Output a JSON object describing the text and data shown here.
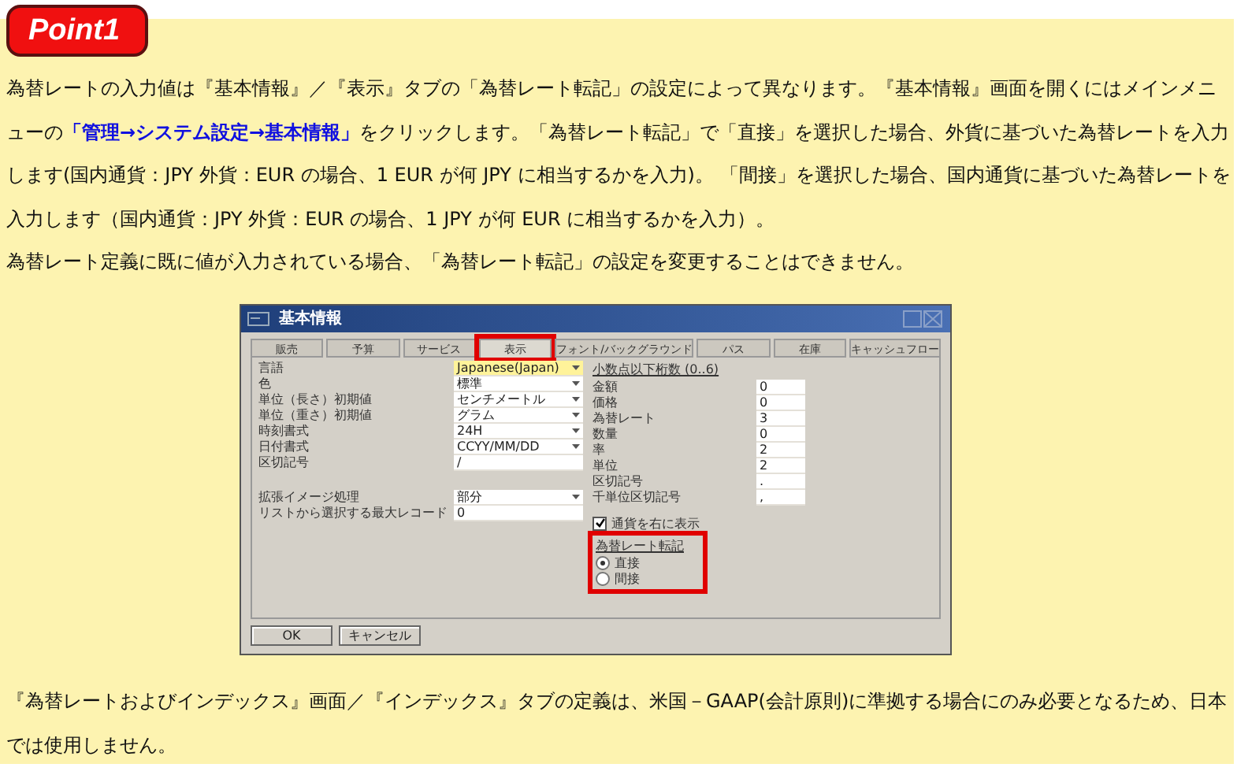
{
  "badge": "Point1",
  "intro": [
    {
      "segments": [
        {
          "kind": "text",
          "text": "為替レートの入力値は『基本情報』／『表示』タブの「為替レート転記」の設定によって異なります。『基本情報』画面を開くにはメインメニューの"
        },
        {
          "kind": "link",
          "text": "「管理→システム設定→基本情報」"
        },
        {
          "kind": "text",
          "text": "をクリックします。「為替レート転記」で「直接」を選択した場合、外貨に基づいた為替レートを入力します(国内通貨：JPY  外貨：EUR の場合、1 EUR が何 JPY に相当するかを入力)。 「間接」を選択した場合、国内通貨に基づいた為替レートを入力します（国内通貨：JPY  外貨：EUR の場合、1 JPY が何 EUR に相当するかを入力）。"
        }
      ]
    },
    {
      "segments": [
        {
          "kind": "text",
          "text": "為替レート定義に既に値が入力されている場合、「為替レート転記」の設定を変更することはできません。"
        }
      ]
    }
  ],
  "dialog": {
    "title": "基本情報",
    "tabs": [
      {
        "label": "販売",
        "selected": false,
        "highlighted": false
      },
      {
        "label": "予算",
        "selected": false,
        "highlighted": false
      },
      {
        "label": "サービス",
        "selected": false,
        "highlighted": false
      },
      {
        "label": "表示",
        "selected": true,
        "highlighted": true
      },
      {
        "label": "フォント/バックグラウンド",
        "selected": false,
        "highlighted": false
      },
      {
        "label": "パス",
        "selected": false,
        "highlighted": false
      },
      {
        "label": "在庫",
        "selected": false,
        "highlighted": false
      },
      {
        "label": "キャッシュフロー",
        "selected": false,
        "highlighted": false
      }
    ],
    "left_groups": [
      [
        {
          "label": "言語",
          "value": "Japanese(Japan)",
          "kind": "dropdown",
          "focused": true
        },
        {
          "label": "色",
          "value": "標準",
          "kind": "dropdown",
          "focused": false
        },
        {
          "label": "単位（長さ）初期値",
          "value": "センチメートル",
          "kind": "dropdown",
          "focused": false
        },
        {
          "label": "単位（重さ）初期値",
          "value": "グラム",
          "kind": "dropdown",
          "focused": false
        },
        {
          "label": "時刻書式",
          "value": "24H",
          "kind": "dropdown",
          "focused": false
        },
        {
          "label": "日付書式",
          "value": "CCYY/MM/DD",
          "kind": "dropdown",
          "focused": false
        },
        {
          "label": "区切記号",
          "value": "/",
          "kind": "text",
          "focused": false
        }
      ],
      [
        {
          "label": "拡張イメージ処理",
          "value": "部分",
          "kind": "dropdown",
          "focused": false
        },
        {
          "label": "リストから選択する最大レコード",
          "value": "0",
          "kind": "text",
          "focused": false
        }
      ]
    ],
    "decimals_title": "小数点以下桁数 (0..6)",
    "decimals": [
      {
        "label": "金額",
        "value": "0"
      },
      {
        "label": "価格",
        "value": "0"
      },
      {
        "label": "為替レート",
        "value": "3"
      },
      {
        "label": "数量",
        "value": "0"
      },
      {
        "label": "率",
        "value": "2"
      },
      {
        "label": "単位",
        "value": "2"
      },
      {
        "label": "区切記号",
        "value": "."
      },
      {
        "label": "千単位区切記号",
        "value": ","
      }
    ],
    "currency_right": {
      "label": "通貨を右に表示",
      "checked": true
    },
    "rate_group": {
      "title": "為替レート転記",
      "highlighted": true,
      "options": [
        {
          "label": "直接",
          "selected": true
        },
        {
          "label": "間接",
          "selected": false
        }
      ]
    },
    "buttons": [
      "OK",
      "キャンセル"
    ]
  },
  "outro": [
    {
      "segments": [
        {
          "kind": "text",
          "text": "『為替レートおよびインデックス』画面／『インデックス』タブの定義は、米国－GAAP(会計原則)に準拠する場合にのみ必要となるため、日本では使用しません。"
        }
      ]
    }
  ]
}
